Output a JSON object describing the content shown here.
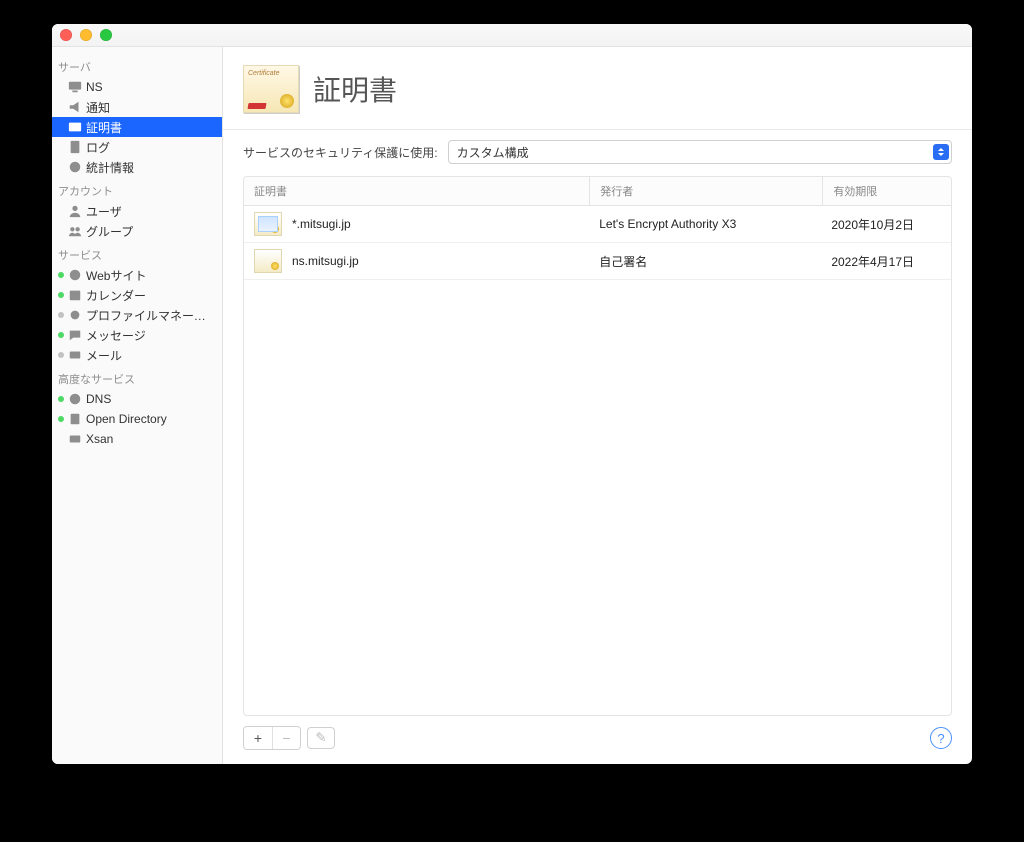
{
  "sidebar": {
    "sections": {
      "server": {
        "title": "サーバ",
        "items": [
          "NS",
          "通知",
          "証明書",
          "ログ",
          "統計情報"
        ]
      },
      "account": {
        "title": "アカウント",
        "items": [
          "ユーザ",
          "グループ"
        ]
      },
      "service": {
        "title": "サービス",
        "items": [
          "Webサイト",
          "カレンダー",
          "プロファイルマネージャ",
          "メッセージ",
          "メール"
        ]
      },
      "advanced": {
        "title": "高度なサービス",
        "items": [
          "DNS",
          "Open Directory",
          "Xsan"
        ]
      }
    }
  },
  "header": {
    "title": "証明書"
  },
  "filter": {
    "label": "サービスのセキュリティ保護に使用:",
    "selected": "カスタム構成"
  },
  "table": {
    "columns": {
      "name": "証明書",
      "issuer": "発行者",
      "expire": "有効期限"
    },
    "rows": [
      {
        "name": "*.mitsugi.jp",
        "issuer": "Let's Encrypt Authority X3",
        "expire": "2020年10月2日",
        "iconKind": "a"
      },
      {
        "name": "ns.mitsugi.jp",
        "issuer": "自己署名",
        "expire": "2022年4月17日",
        "iconKind": "b"
      }
    ]
  },
  "buttons": {
    "add": "+",
    "remove": "−",
    "edit": "✎",
    "help": "?"
  }
}
